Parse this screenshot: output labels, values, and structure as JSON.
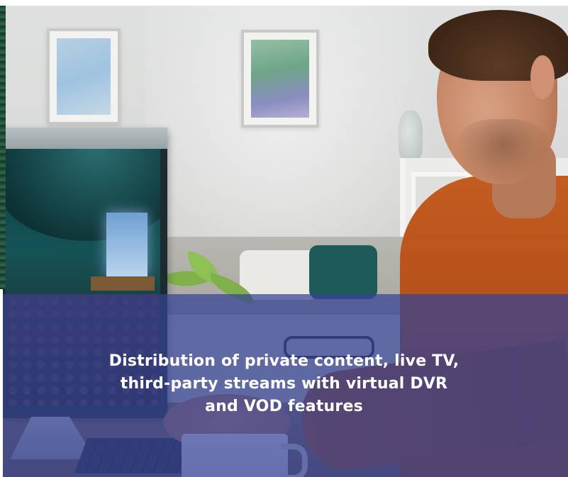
{
  "caption": {
    "lines": [
      "Distribution of private content, live TV,",
      "third-party streams with virtual DVR",
      "and VOD features"
    ]
  },
  "colors": {
    "overlay": "#344396",
    "caption_text": "#ffffff",
    "shirt": "#b6511b"
  },
  "image": {
    "subject": "man-watching-livestream-on-monitor"
  }
}
